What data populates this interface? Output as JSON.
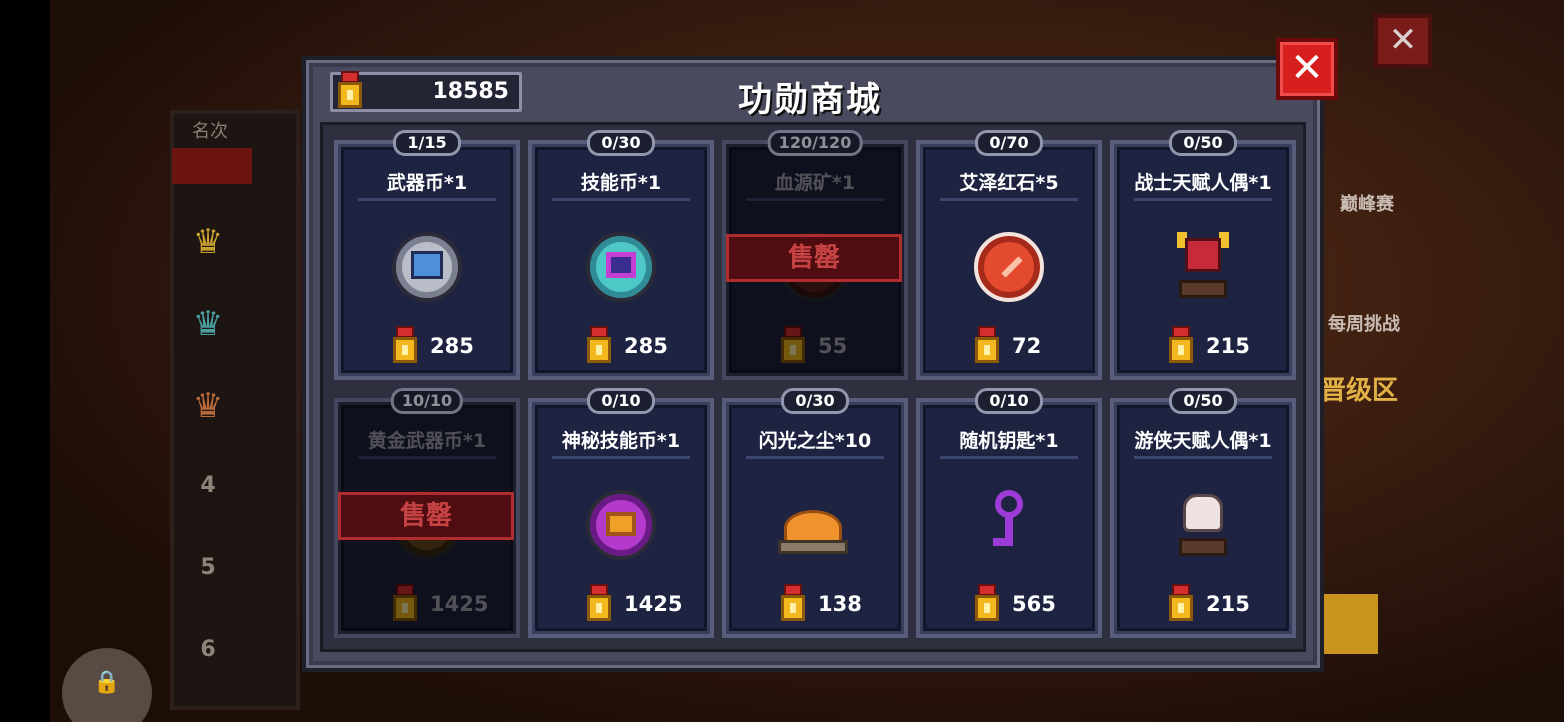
{
  "background": {
    "rank_header": "名次",
    "rank_numbers": [
      "1",
      "2",
      "3",
      "4",
      "5",
      "6"
    ],
    "right_labels": {
      "peak": "巅峰赛",
      "weekly": "每周挑战",
      "zone": "晋级区"
    }
  },
  "shop": {
    "title": "功勋商城",
    "currency": {
      "icon": "medal-icon",
      "amount": "18585"
    },
    "close_label": "✕",
    "soldout_label": "售罄",
    "items": [
      {
        "name": "武器币*1",
        "stock": "1/15",
        "price": "285",
        "icon": "weapon-coin-icon",
        "soldout": false
      },
      {
        "name": "技能币*1",
        "stock": "0/30",
        "price": "285",
        "icon": "skill-coin-icon",
        "soldout": false
      },
      {
        "name": "血源矿*1",
        "stock": "120/120",
        "price": "55",
        "icon": "blood-ore-icon",
        "soldout": true
      },
      {
        "name": "艾泽红石*5",
        "stock": "0/70",
        "price": "72",
        "icon": "red-stone-icon",
        "soldout": false
      },
      {
        "name": "战士天赋人偶*1",
        "stock": "0/50",
        "price": "215",
        "icon": "warrior-doll-icon",
        "soldout": false
      },
      {
        "name": "黄金武器币*1",
        "stock": "10/10",
        "price": "1425",
        "icon": "gold-weapon-coin-icon",
        "soldout": true
      },
      {
        "name": "神秘技能币*1",
        "stock": "0/10",
        "price": "1425",
        "icon": "mystic-skill-coin-icon",
        "soldout": false
      },
      {
        "name": "闪光之尘*10",
        "stock": "0/30",
        "price": "138",
        "icon": "glitter-dust-icon",
        "soldout": false
      },
      {
        "name": "随机钥匙*1",
        "stock": "0/10",
        "price": "565",
        "icon": "random-key-icon",
        "soldout": false
      },
      {
        "name": "游侠天赋人偶*1",
        "stock": "0/50",
        "price": "215",
        "icon": "ranger-doll-icon",
        "soldout": false
      }
    ]
  }
}
